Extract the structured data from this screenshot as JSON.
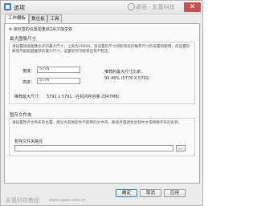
{
  "window": {
    "title": "选项",
    "close_glyph": "✕"
  },
  "watermark": {
    "text": "桌面 · 友基科技"
  },
  "tabs": [
    {
      "label": "工作模板",
      "active": true
    },
    {
      "label": "数位板",
      "active": false
    },
    {
      "label": "工具",
      "active": false
    }
  ],
  "tip": "※ 该标签的设置需重启ZAI才能生效",
  "max_size": {
    "title": "最大图像尺寸",
    "description": "请设置绘画图像允许的最大尺寸，上限为10000。该设置的尺寸将影响您的推荐尺寸的设置和使用，您设置的数值尽能超越推荐的最大尺寸，设置软件可能将出现不稳定。",
    "width_label": "宽度：",
    "width_value": "5776",
    "height_label": "高度：",
    "height_value": "5776",
    "ratio_label": "推荐的最大尺寸比率：",
    "ratio_value": "99.48% (5776 X 5791)",
    "recommended_label": "推荐最大尺寸：",
    "recommended_value": "5791 x 5791（在机内存容量 2047MB）"
  },
  "temp_folder": {
    "title": "暂存文件夹",
    "description": "请设置暂存文件夹的位置。建议为其他软件不使用的文件夹，路径尽量避免出现中文或特殊字符的名称。",
    "path_label": "暂存文件夹路径",
    "path_value": "",
    "browse_label": "..."
  },
  "buttons": {
    "ok": "确定",
    "cancel": "取消",
    "apply": "应用"
  },
  "footer": {
    "brand": "友基科技教程",
    "url": "www.ugee.com.cn"
  }
}
